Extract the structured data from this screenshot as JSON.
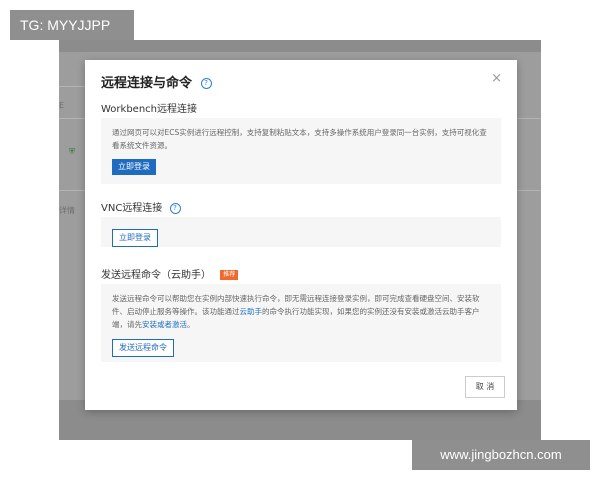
{
  "overlay": {
    "tg_badge": "TG: MYYJJPP",
    "watermark": "www.jingbozhcn.com"
  },
  "background": {
    "partial_text_1": "E",
    "partial_text_2": "详情"
  },
  "modal": {
    "title": "远程连接与命令",
    "close_glyph": "×",
    "sections": {
      "workbench": {
        "title": "Workbench远程连接",
        "description": "通过网页可以对ECS实例进行远程控制，支持复制粘贴文本，支持多操作系统用户登录同一台实例，支持可视化查看系统文件资源。",
        "button_label": "立即登录"
      },
      "vnc": {
        "title": "VNC远程连接",
        "button_label": "立即登录"
      },
      "remote_command": {
        "title": "发送远程命令（云助手）",
        "badge": "推荐",
        "description_part1": "发送远程命令可以帮助您在实例内部快速执行命令，即无需远程连接登录实例，即可完成查看硬盘空间、安装软件、启动停止服务等操作。该功能通过",
        "link_cloud_assistant": "云助手",
        "description_part2": "的命令执行功能实现，如果您的实例还没有安装或激活云助手客户端，请先",
        "link_install": "安装或者激活",
        "description_end": "。",
        "button_label": "发送远程命令"
      }
    },
    "footer": {
      "cancel_label": "取 消"
    }
  }
}
